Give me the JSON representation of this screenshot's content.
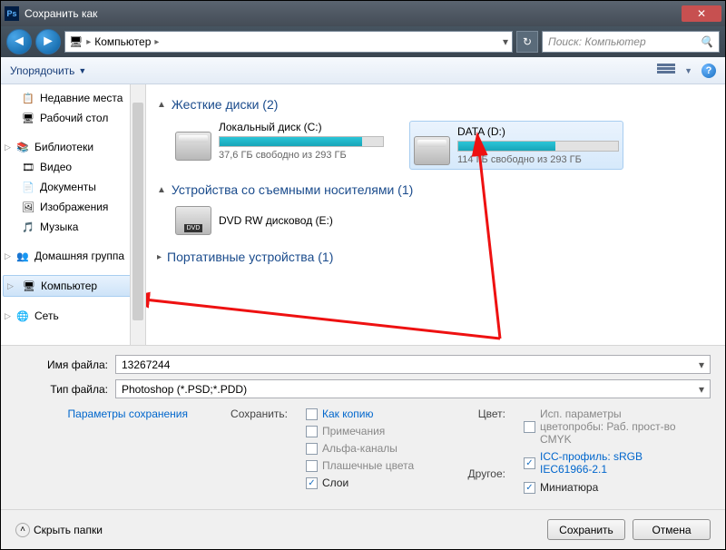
{
  "title": "Сохранить как",
  "nav": {
    "location": "Компьютер",
    "search_placeholder": "Поиск: Компьютер"
  },
  "toolbar": {
    "organize": "Упорядочить"
  },
  "sidebar": {
    "recent": "Недавние места",
    "desktop": "Рабочий стол",
    "libraries": "Библиотеки",
    "videos": "Видео",
    "documents": "Документы",
    "pictures": "Изображения",
    "music": "Музыка",
    "homegroup": "Домашняя группа",
    "computer": "Компьютер",
    "network": "Сеть"
  },
  "categories": {
    "hdd": "Жесткие диски (2)",
    "removable": "Устройства со съемными носителями (1)",
    "portable": "Портативные устройства (1)"
  },
  "drives": {
    "c": {
      "name": "Локальный диск (C:)",
      "free": "37,6 ГБ свободно из 293 ГБ",
      "fill_pct": 87
    },
    "d": {
      "name": "DATA (D:)",
      "free": "114 ГБ свободно из 293 ГБ",
      "fill_pct": 61
    },
    "e": {
      "name": "DVD RW дисковод (E:)"
    }
  },
  "filename": {
    "label": "Имя файла:",
    "value": "13267244"
  },
  "filetype": {
    "label": "Тип файла:",
    "value": "Photoshop (*.PSD;*.PDD)"
  },
  "save_params": "Параметры сохранения",
  "save_opts": {
    "label": "Сохранить:",
    "as_copy": "Как копию",
    "notes": "Примечания",
    "alpha": "Альфа-каналы",
    "spot": "Плашечные цвета",
    "layers": "Слои"
  },
  "color_opts": {
    "label": "Цвет:",
    "proof": "Исп. параметры цветопробы: Раб. прост-во CMYK",
    "icc": "ICC-профиль: sRGB IEC61966-2.1"
  },
  "other_opts": {
    "label": "Другое:",
    "thumb": "Миниатюра"
  },
  "footer": {
    "hide": "Скрыть папки",
    "save": "Сохранить",
    "cancel": "Отмена"
  }
}
